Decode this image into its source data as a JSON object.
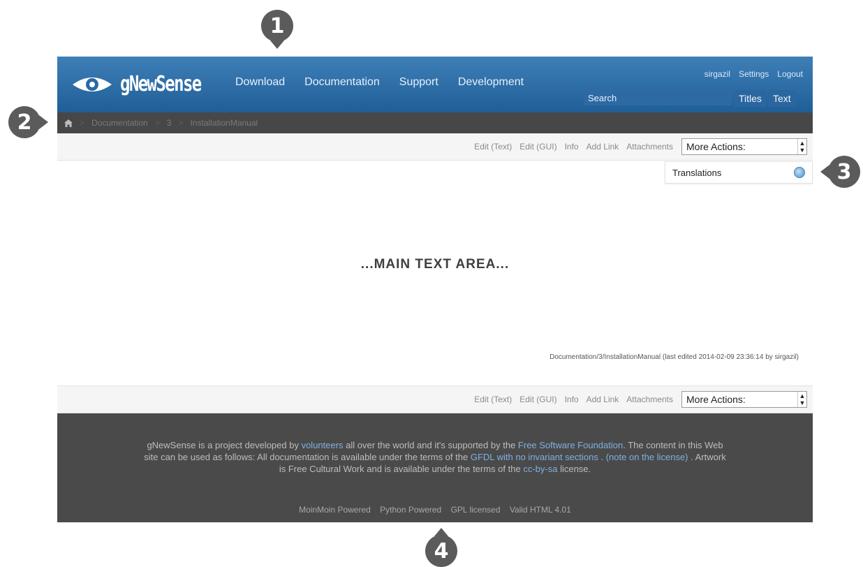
{
  "callouts": [
    "1",
    "2",
    "3",
    "4"
  ],
  "header": {
    "logo_text": "gNewSense",
    "nav": [
      "Download",
      "Documentation",
      "Support",
      "Development"
    ],
    "user_links": [
      "sirgazil",
      "Settings",
      "Logout"
    ],
    "search": {
      "placeholder": "Search",
      "titles_button": "Titles",
      "text_button": "Text"
    }
  },
  "breadcrumb": {
    "home_icon": "home-icon",
    "items": [
      "Documentation",
      "3",
      "InstallationManual"
    ]
  },
  "actions": {
    "links": [
      "Edit (Text)",
      "Edit (GUI)",
      "Info",
      "Add Link",
      "Attachments"
    ],
    "more_actions": "More Actions:"
  },
  "translations": {
    "label": "Translations",
    "icon": "globe-icon"
  },
  "content": {
    "main_text": "...MAIN TEXT AREA...",
    "page_info": "Documentation/3/InstallationManual (last edited 2014-02-09 23:36:14 by sirgazil)"
  },
  "footer": {
    "blurb": {
      "t1": "gNewSense is a project developed by ",
      "l1": "volunteers",
      "t2": " all over the world and it's supported by the ",
      "l2": "Free Software Foundation",
      "t3": ". The content in this Web site can be used as follows: All documentation is available under the terms of the ",
      "l3": "GFDL with no invariant sections",
      "t4": " . ",
      "l4": "(note on the license)",
      "t5": " . Artwork is Free Cultural Work and is available under the terms of the ",
      "l5": "cc-by-sa",
      "t6": " license."
    },
    "powered": [
      "MoinMoin Powered",
      "Python Powered",
      "GPL licensed",
      "Valid HTML 4.01"
    ]
  },
  "colors": {
    "header_blue": "#2a6aa6",
    "breadcrumb_bg": "#474747",
    "footer_bg": "#4a4a4a",
    "link_blue": "#7fb0e0"
  }
}
